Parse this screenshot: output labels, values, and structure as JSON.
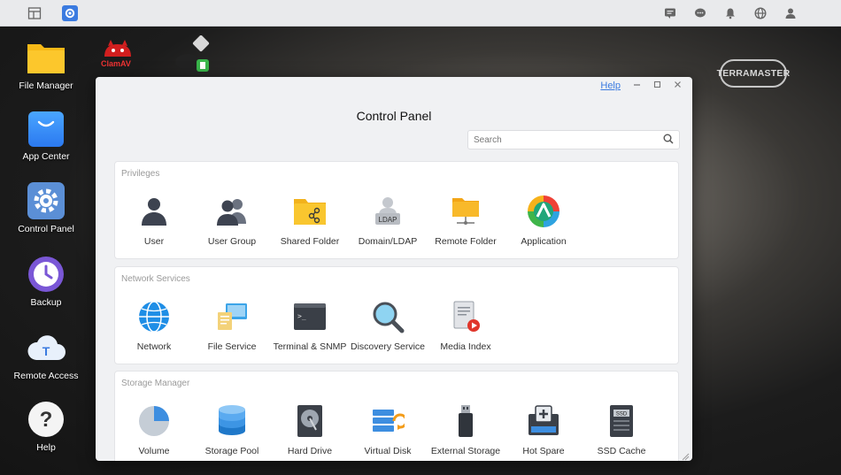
{
  "taskbar": {
    "left_icons": [
      "windows-icon",
      "control-panel-icon"
    ],
    "right_icons": [
      "message-icon",
      "chat-icon",
      "bell-icon",
      "globe-icon",
      "user-icon"
    ]
  },
  "desktop": {
    "icons": [
      {
        "label": "File Manager",
        "icon": "folder-icon"
      },
      {
        "label": "App Center",
        "icon": "shopping-bag-icon"
      },
      {
        "label": "Control Panel",
        "icon": "gear-icon"
      },
      {
        "label": "Backup",
        "icon": "backup-clock-icon"
      },
      {
        "label": "Remote Access",
        "icon": "cloud-icon"
      },
      {
        "label": "Help",
        "icon": "help-icon"
      }
    ],
    "clamav_label": "ClamAV",
    "brand": "TERRAMASTER"
  },
  "window": {
    "title": "Control Panel",
    "help_label": "Help",
    "search_placeholder": "Search",
    "sections": [
      {
        "title": "Privileges",
        "items": [
          {
            "label": "User",
            "icon": "user-icon"
          },
          {
            "label": "User Group",
            "icon": "user-group-icon"
          },
          {
            "label": "Shared Folder",
            "icon": "shared-folder-icon"
          },
          {
            "label": "Domain/LDAP",
            "icon": "ldap-icon"
          },
          {
            "label": "Remote Folder",
            "icon": "remote-folder-icon"
          },
          {
            "label": "Application",
            "icon": "application-icon"
          }
        ]
      },
      {
        "title": "Network Services",
        "items": [
          {
            "label": "Network",
            "icon": "network-globe-icon"
          },
          {
            "label": "File Service",
            "icon": "file-service-icon"
          },
          {
            "label": "Terminal & SNMP",
            "icon": "terminal-icon"
          },
          {
            "label": "Discovery Service",
            "icon": "magnifier-icon"
          },
          {
            "label": "Media Index",
            "icon": "media-index-icon"
          }
        ]
      },
      {
        "title": "Storage Manager",
        "items": [
          {
            "label": "Volume",
            "icon": "volume-pie-icon"
          },
          {
            "label": "Storage Pool",
            "icon": "storage-pool-icon"
          },
          {
            "label": "Hard Drive",
            "icon": "hard-drive-icon"
          },
          {
            "label": "Virtual Disk",
            "icon": "virtual-disk-icon"
          },
          {
            "label": "External Storage",
            "icon": "usb-drive-icon"
          },
          {
            "label": "Hot Spare",
            "icon": "hot-spare-icon"
          },
          {
            "label": "SSD Cache",
            "icon": "ssd-cache-icon"
          }
        ]
      }
    ]
  }
}
